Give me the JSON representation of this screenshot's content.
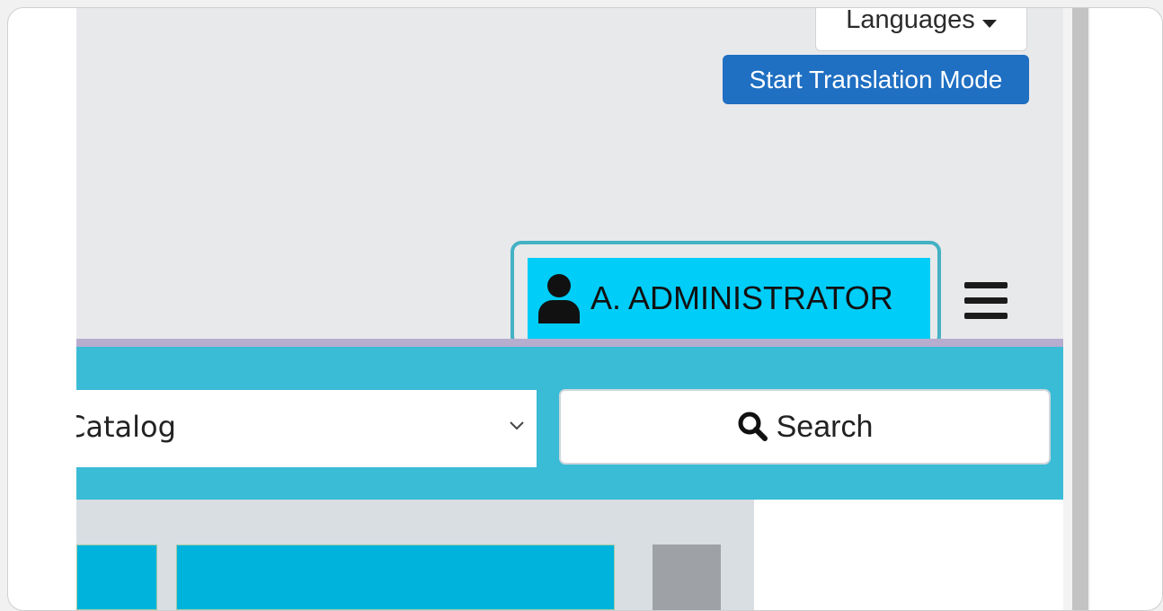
{
  "header": {
    "languages_label": "Languages",
    "translation_button": "Start Translation Mode"
  },
  "user": {
    "name": "A. ADMINISTRATOR",
    "icon": "user-icon"
  },
  "menu": {
    "icon": "hamburger-menu-icon"
  },
  "search": {
    "scope_value": "Catalog",
    "button_label": "Search",
    "icon": "search-icon"
  },
  "colors": {
    "accent": "#00cdf8",
    "band": "#3abbd6",
    "primary_button": "#1f6fc2",
    "highlight_border": "#44b1c4"
  }
}
